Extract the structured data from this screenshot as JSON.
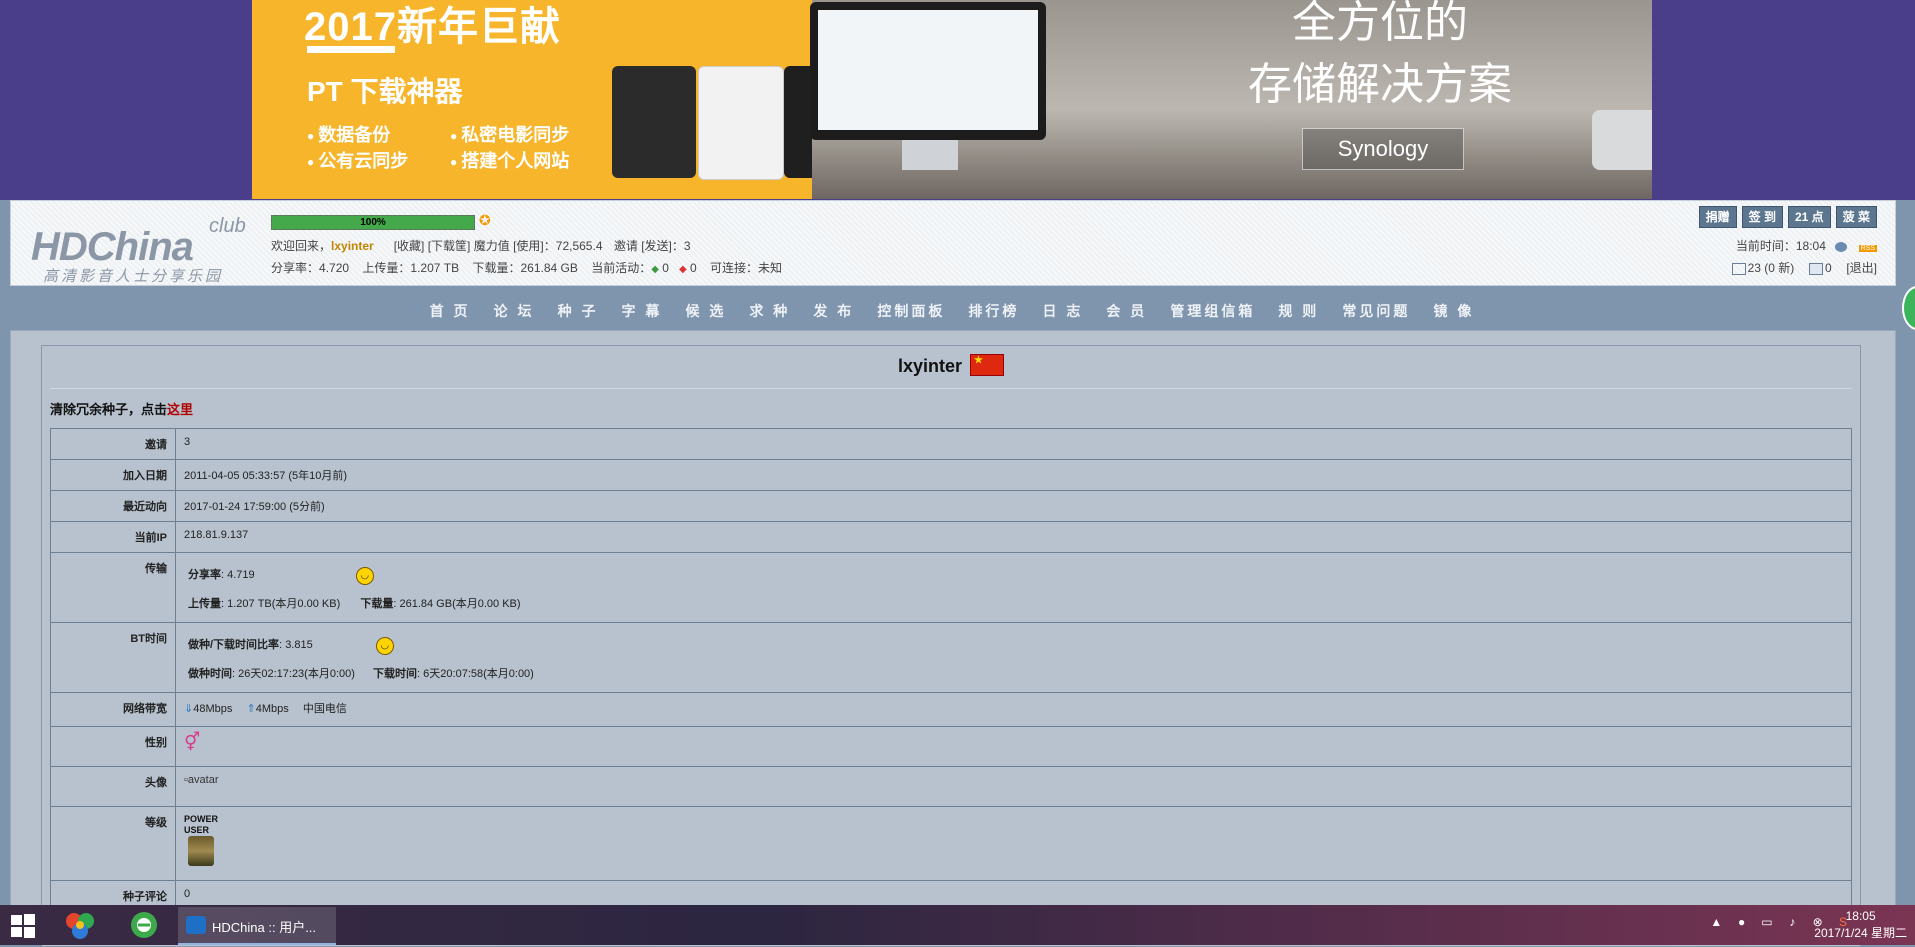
{
  "banner": {
    "title": "2017新年巨献",
    "subtitle": "PT 下载神器",
    "features": [
      "数据备份",
      "私密电影同步",
      "公有云同步",
      "搭建个人网站"
    ],
    "slogan_line1": "全方位的",
    "slogan_line2": "存储解决方案",
    "brand": "Synology"
  },
  "header": {
    "logo_main": "HDChina",
    "logo_club": "club",
    "logo_tagline": "高清影音人士分享乐园",
    "progress_percent": 100,
    "progress_label": "100%",
    "welcome_prefix": "欢迎回来，",
    "username": "lxyinter",
    "fav_link": "[收藏]",
    "download_box_link": "[下载筐]",
    "magic_label": "魔力值",
    "magic_use_link": "[使用]",
    "magic_value": "72,565.4",
    "invite_label": "邀请",
    "invite_send_link": "[发送]",
    "invite_value": "3",
    "ratio_label": "分享率：",
    "ratio_value": "4.720",
    "upload_label": "上传量：",
    "upload_value": "1.207 TB",
    "download_label": "下载量：",
    "download_value": "261.84 GB",
    "active_label": "当前活动：",
    "active_seeding": "0",
    "active_leeching": "0",
    "connectable_label": "可连接：",
    "connectable_value": "未知",
    "buttons": [
      "捐赠",
      "签 到",
      "21 点",
      "菠 菜"
    ],
    "time_label": "当前时间：",
    "time_value": "18:04",
    "rss_badge": "RSS",
    "inbox_text": "23 (0 新)",
    "sent_count": "0",
    "logout_link": "[退出]"
  },
  "nav": [
    "首 页",
    "论 坛",
    "种 子",
    "字 幕",
    "候 选",
    "求 种",
    "发 布",
    "控制面板",
    "排行榜",
    "日 志",
    "会 员",
    "管理组信箱",
    "规 则",
    "常见问题",
    "镜 像"
  ],
  "profile": {
    "username": "lxyinter",
    "flag_star": "★",
    "clean_text": "清除冗余种子，点击",
    "clean_link": "这里",
    "rows": {
      "invites_label": "邀请",
      "invites_value": "3",
      "joined_label": "加入日期",
      "joined_value": "2011-04-05 05:33:57 (5年10月前)",
      "last_action_label": "最近动向",
      "last_action_value": "2017-01-24 17:59:00 (5分前)",
      "ip_label": "当前IP",
      "ip_value": "218.81.9.137",
      "transfer_label": "传输",
      "share_ratio_label": "分享率",
      "share_ratio_value": "4.719",
      "uploaded_label": "上传量",
      "uploaded_value": "1.207 TB(本月0.00 KB)",
      "downloaded_label": "下载量",
      "downloaded_value": "261.84 GB(本月0.00 KB)",
      "bt_time_label": "BT时间",
      "seed_ratio_label": "做种/下载时间比率",
      "seed_ratio_value": "3.815",
      "seed_time_label": "做种时间",
      "seed_time_value": "26天02:17:23(本月0:00)",
      "leech_time_label": "下载时间",
      "leech_time_value": "6天20:07:58(本月0:00)",
      "bandwidth_label": "网络带宽",
      "bandwidth_down": "48Mbps",
      "bandwidth_up": "4Mbps",
      "isp": "中国电信",
      "gender_label": "性别",
      "avatar_label": "头像",
      "avatar_alt": "avatar",
      "class_label": "等级",
      "class_text": "POWER USER",
      "comments_label": "种子评论",
      "comments_value": "0"
    }
  },
  "taskbar": {
    "active_window": "HDChina :: 用户...",
    "clock_time": "18:05",
    "clock_date": "2017/1/24 星期二"
  }
}
